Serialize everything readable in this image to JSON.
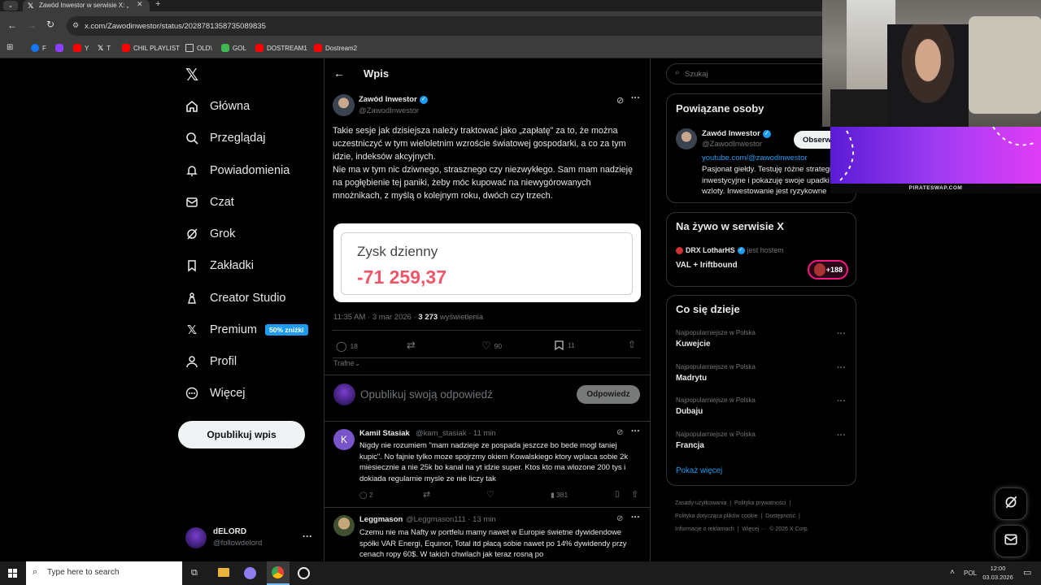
{
  "browser": {
    "tab_title": "Zawód Inwestor w serwisie X: „",
    "url": "x.com/Zawodinwestor/status/2028781358735089835",
    "bookmarks": [
      {
        "label": "F",
        "color": "#1877f2"
      },
      {
        "label": "",
        "color": "#8a3ffc"
      },
      {
        "label": "Y",
        "color": "#ff0000"
      },
      {
        "label": "T",
        "color": "#ffffff"
      },
      {
        "label": "CHIL PLAYLIST",
        "color": "#ff0000"
      },
      {
        "label": "OLD\\",
        "color": "#cccccc"
      },
      {
        "label": "GOL",
        "color": "#3fb950"
      },
      {
        "label": "DOSTREAM1",
        "color": "#ff0000"
      },
      {
        "label": "Dostream2",
        "color": "#ff0000"
      }
    ]
  },
  "nav": {
    "items": [
      {
        "label": "Główna",
        "icon": "home-icon"
      },
      {
        "label": "Przeglądaj",
        "icon": "search-icon"
      },
      {
        "label": "Powiadomienia",
        "icon": "bell-icon"
      },
      {
        "label": "Czat",
        "icon": "mail-icon"
      },
      {
        "label": "Grok",
        "icon": "grok-icon"
      },
      {
        "label": "Zakładki",
        "icon": "bookmark-icon"
      },
      {
        "label": "Creator Studio",
        "icon": "creator-icon"
      },
      {
        "label": "Premium",
        "icon": "x-logo-icon"
      },
      {
        "label": "Profil",
        "icon": "person-icon"
      },
      {
        "label": "Więcej",
        "icon": "more-circle-icon"
      }
    ],
    "premium_badge": "50% zniżki",
    "post_button": "Opublikuj wpis",
    "account_name": "dELORD",
    "account_handle": "@followdelord"
  },
  "post": {
    "header_title": "Wpis",
    "author_name": "Zawód Inwestor",
    "author_handle": "@ZawodInwestor",
    "text_p1": "Takie sesje jak dzisiejsza należy traktować jako „zapłatę” za to, że można uczestniczyć w tym wieloletnim wzroście światowej gospodarki, a co za tym idzie, indeksów akcyjnych.",
    "text_p2": "Nie ma w tym nic dziwnego, strasznego czy niezwykłego. Sam mam nadzieję na pogłębienie tej paniki, żeby móc kupować na niewygórowanych mnożnikach, z myślą o kolejnym roku, dwóch czy trzech.",
    "image_label": "Zysk dzienny",
    "image_value": "-71 259,37",
    "timestamp": "11:35 AM · 3 mar 2026 ·",
    "views_count": "3 273",
    "views_label": "wyświetlenia",
    "replies": "18",
    "likes": "90",
    "bookmarks": "11",
    "sort_label": "Trafne",
    "reply_placeholder": "Opublikuj swoją odpowiedź",
    "reply_button": "Odpowiedz"
  },
  "comments": [
    {
      "name": "Kamil Stasiak",
      "handle": "@kam_stasiak · 11 min",
      "avatar_letter": "K",
      "text": "Nigdy nie rozumiem \"mam nadzieje ze pospada jeszcze bo bede mogl taniej kupic\". No fajnie tylko moze spojrzmy okiem Kowalskiego ktory wplaca sobie 2k miesiecznie a nie 25k bo kanal na yt idzie super. Ktos kto ma wlozone 200 tys i dokiada regularnie mysle ze nie liczy tak",
      "replies": "2",
      "views": "381"
    },
    {
      "name": "Leggmason",
      "handle": "@Leggmason111 · 13 min",
      "avatar_letter": "",
      "text": "Czemu nie ma Nafty w portfelu mamy nawet w Europie świetne dywidendowe spółki VAR Energi, Equinor, Total itd płacą sobie nawet po 14% dywidendy przy cenach ropy 60$. W takich chwilach jak teraz rosną po"
    }
  ],
  "sidebar": {
    "search_placeholder": "Szukaj",
    "related_title": "Powiązane osoby",
    "related_name": "Zawód Inwestor",
    "related_handle": "@ZawodInwestor",
    "related_follow": "Obserwuj",
    "related_link": "youtube.com/@zawodinwestor",
    "related_bio": "Pasjonat giełdy. Testuję różne strategie inwestycyjne i pokazuję swoje upadki i wzloty. Inwestowanie jest ryzykowne",
    "live_title": "Na żywo w serwisie X",
    "live_host": "DRX LotharHS",
    "live_host_suffix": "jest hostem",
    "live_name": "VAL + Iriftbound",
    "live_count": "+188",
    "trends_title": "Co się dzieje",
    "trends": [
      {
        "context": "Najpopularniejsze w Polska",
        "name": "Kuwejcie"
      },
      {
        "context": "Najpopularniejsze w Polska",
        "name": "Madrytu"
      },
      {
        "context": "Najpopularniejsze w Polska",
        "name": "Dubaju"
      },
      {
        "context": "Najpopularniejsze w Polska",
        "name": "Francja"
      }
    ],
    "show_more": "Pokaż więcej",
    "footer_links": [
      "Zasady użytkowania",
      "Polityka prywatności",
      "Polityka dotycząca plików cookie",
      "Dostępność",
      "Informacje o reklamach",
      "Więcej ···",
      "© 2026 X Corp."
    ]
  },
  "overlay": {
    "banner_text": "PIRATESWAP.COM"
  },
  "taskbar": {
    "search_placeholder": "Type here to search",
    "lang": "POL",
    "time": "12:00",
    "date": "03.03.2026"
  },
  "colors": {
    "accent": "#1d9bf0",
    "loss_red": "#f4212e",
    "premium_badge": "#1d9bf0"
  }
}
